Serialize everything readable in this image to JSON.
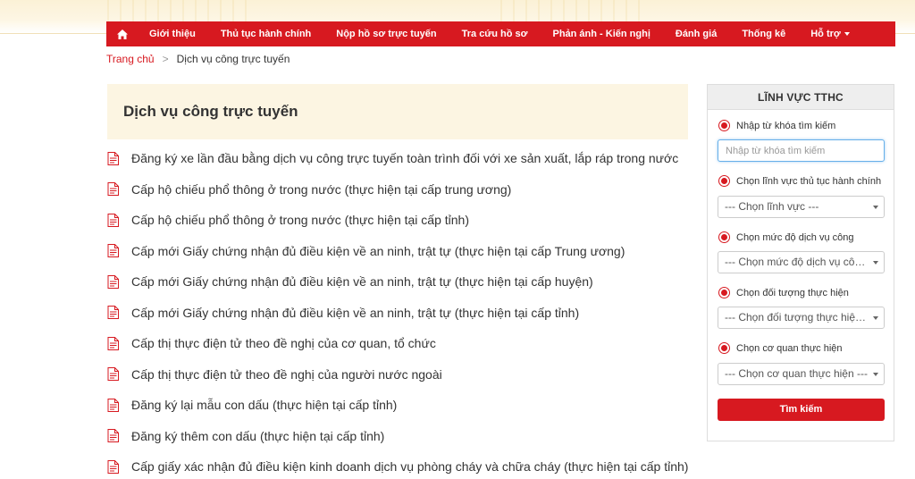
{
  "nav": {
    "items": [
      {
        "label": "Giới thiệu"
      },
      {
        "label": "Thủ tục hành chính"
      },
      {
        "label": "Nộp hồ sơ trực tuyến"
      },
      {
        "label": "Tra cứu hồ sơ"
      },
      {
        "label": "Phản ánh - Kiến nghị"
      },
      {
        "label": "Đánh giá"
      },
      {
        "label": "Thống kê"
      },
      {
        "label": "Hỗ trợ"
      }
    ]
  },
  "breadcrumb": {
    "home": "Trang chủ",
    "separator": ">",
    "current": "Dịch vụ công trực tuyến"
  },
  "main": {
    "title": "Dịch vụ công trực tuyến",
    "services": [
      "Đăng ký xe lần đầu bằng dịch vụ công trực tuyến toàn trình đối với xe sản xuất, lắp ráp trong nước",
      "Cấp hộ chiếu phổ thông ở trong nước (thực hiện tại cấp trung ương)",
      "Cấp hộ chiếu phổ thông ở trong nước (thực hiện tại cấp tỉnh)",
      "Cấp mới Giấy chứng nhận đủ điều kiện về an ninh, trật tự (thực hiện tại cấp Trung ương)",
      "Cấp mới Giấy chứng nhận đủ điều kiện về an ninh, trật tự (thực hiện tại cấp huyện)",
      "Cấp mới Giấy chứng nhận đủ điều kiện về an ninh, trật tự (thực hiện tại cấp tỉnh)",
      "Cấp thị thực điện tử theo đề nghị của cơ quan, tổ chức",
      "Cấp thị thực điện tử theo đề nghị của người nước ngoài",
      "Đăng ký lại mẫu con dấu (thực hiện tại cấp tỉnh)",
      "Đăng ký thêm con dấu (thực hiện tại cấp tỉnh)",
      "Cấp giấy xác nhận đủ điều kiện kinh doanh dịch vụ phòng cháy và chữa cháy (thực hiện tại cấp tỉnh)"
    ],
    "icon": "document-icon"
  },
  "sidebar": {
    "title": "LĨNH VỰC TTHC",
    "keyword_label": "Nhập từ khóa tìm kiếm",
    "keyword_placeholder": "Nhập từ khóa tìm kiếm",
    "field_label": "Chọn lĩnh vực thủ tục hành chính",
    "field_select": "--- Chọn lĩnh vực ---",
    "level_label": "Chọn mức độ dịch vụ công",
    "level_select": "--- Chọn mức độ dịch vụ công ---",
    "subject_label": "Chọn đối tượng thực hiện",
    "subject_select": "--- Chọn đối tượng thực hiện ---",
    "agency_label": "Chọn cơ quan thực hiện",
    "agency_select": "--- Chọn cơ quan thực hiện ---",
    "search_button": "Tìm kiếm"
  },
  "colors": {
    "brand_red": "#d71920",
    "title_bg": "#fcf5e2",
    "panel_head_bg": "#eeeeee"
  }
}
